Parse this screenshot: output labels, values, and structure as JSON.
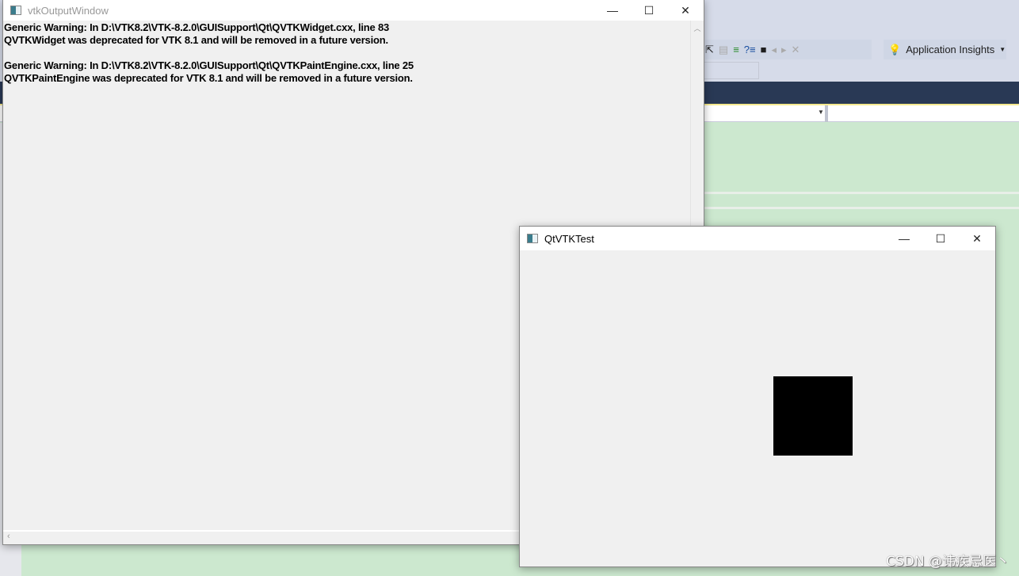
{
  "ide": {
    "toolbar": {
      "app_insights_label": "Application Insights",
      "icons": [
        "select-icon",
        "comment-icon",
        "indent-icon",
        "help-indent-icon",
        "bookmark-icon",
        "prev-bookmark-icon",
        "next-bookmark-icon",
        "clear-bookmark-icon"
      ]
    },
    "colors": {
      "editor_bg": "#cce8cf",
      "title_bar": "#293955",
      "toolbar_bg": "#d6dbe9"
    }
  },
  "output_window": {
    "title": "vtkOutputWindow",
    "lines": [
      "Generic Warning: In D:\\VTK8.2\\VTK-8.2.0\\GUISupport\\Qt\\QVTKWidget.cxx, line 83",
      "QVTKWidget was deprecated for VTK 8.1 and will be removed in a future version.",
      "",
      "Generic Warning: In D:\\VTK8.2\\VTK-8.2.0\\GUISupport\\Qt\\QVTKPaintEngine.cxx, line 25",
      "QVTKPaintEngine was deprecated for VTK 8.1 and will be removed in a future version."
    ]
  },
  "qt_window": {
    "title": "QtVTKTest"
  },
  "window_controls": {
    "minimize": "—",
    "maximize": "☐",
    "close": "✕"
  },
  "watermark": "CSDN @讳疾忌医丶"
}
